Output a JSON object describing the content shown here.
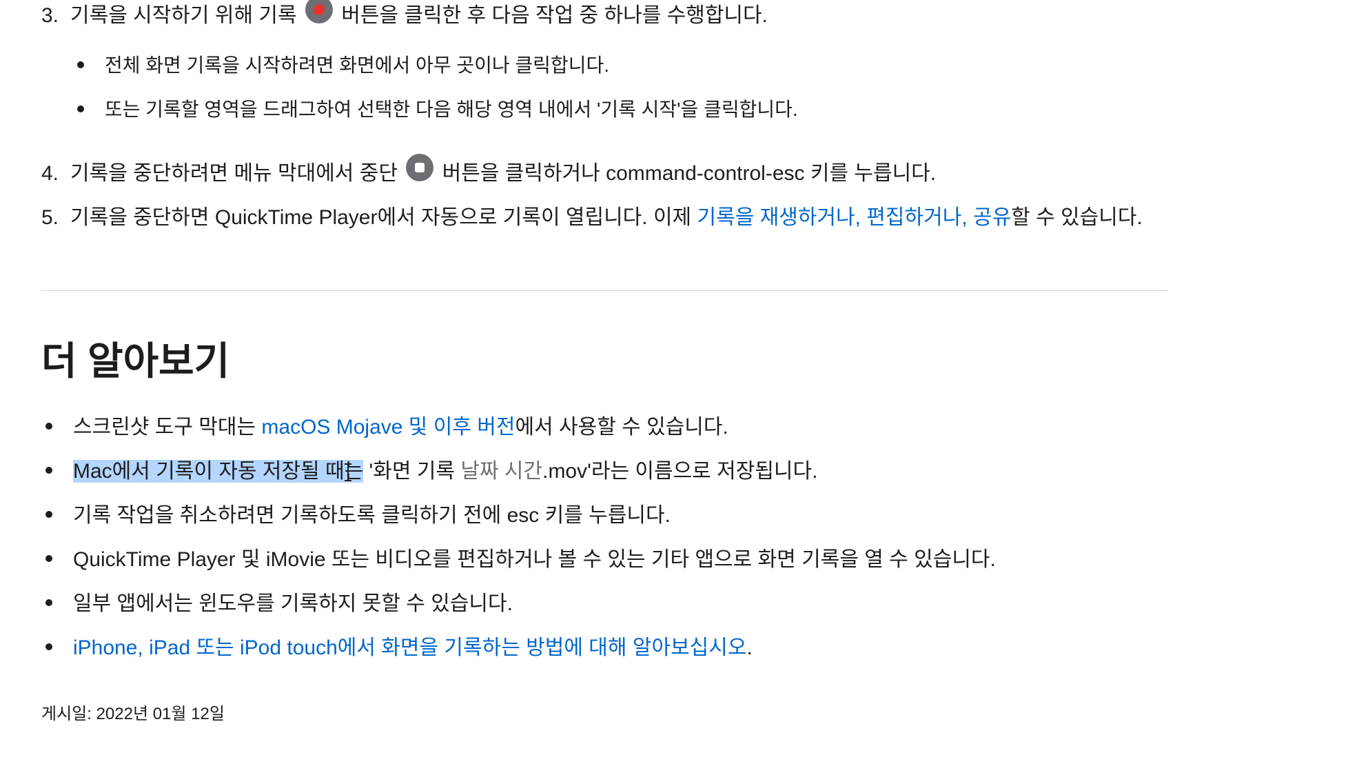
{
  "steps": [
    {
      "number": "3.",
      "text_before": "기록을 시작하기 위해 기록 ",
      "icon": "record-icon",
      "text_after": " 버튼을 클릭한 후 다음 작업 중 하나를 수행합니다.",
      "sub_items": [
        "전체 화면 기록을 시작하려면 화면에서 아무 곳이나 클릭합니다.",
        "또는 기록할 영역을 드래그하여 선택한 다음 해당 영역 내에서 '기록 시작'을 클릭합니다."
      ]
    },
    {
      "number": "4.",
      "text_before": "기록을 중단하려면 메뉴 막대에서 중단 ",
      "icon": "stop-icon",
      "text_after": " 버튼을 클릭하거나 command-control-esc 키를 누릅니다."
    },
    {
      "number": "5.",
      "text_before": "기록을 중단하면 QuickTime Player에서 자동으로 기록이 열립니다. 이제 ",
      "link_text": "기록을 재생하거나, 편집하거나, 공유",
      "text_after": "할 수 있습니다."
    }
  ],
  "learn_more": {
    "title": "더 알아보기",
    "items": [
      {
        "before": "스크린샷 도구 막대는 ",
        "link": "macOS Mojave 및 이후 버전",
        "after": "에서 사용할 수 있습니다."
      },
      {
        "selected": "Mac에서 기록이 자동 저장될 때는",
        "before": " '화면 기록 ",
        "muted": "날짜 시간",
        "after": ".mov'라는 이름으로 저장됩니다."
      },
      {
        "text": "기록 작업을 취소하려면 기록하도록 클릭하기 전에 esc 키를 누릅니다."
      },
      {
        "text": "QuickTime Player 및 iMovie 또는 비디오를 편집하거나 볼 수 있는 기타 앱으로 화면 기록을 열 수 있습니다."
      },
      {
        "text": "일부 앱에서는 윈도우를 기록하지 못할 수 있습니다."
      },
      {
        "link": "iPhone, iPad 또는 iPod touch에서 화면을 기록하는 방법에 대해 알아보십시오",
        "after": "."
      }
    ]
  },
  "posted_date": "게시일: 2022년 01월 12일",
  "colors": {
    "link": "#0066cc",
    "text": "#1d1d1f",
    "selection": "#b4d5fe",
    "record": "#e8342c"
  }
}
